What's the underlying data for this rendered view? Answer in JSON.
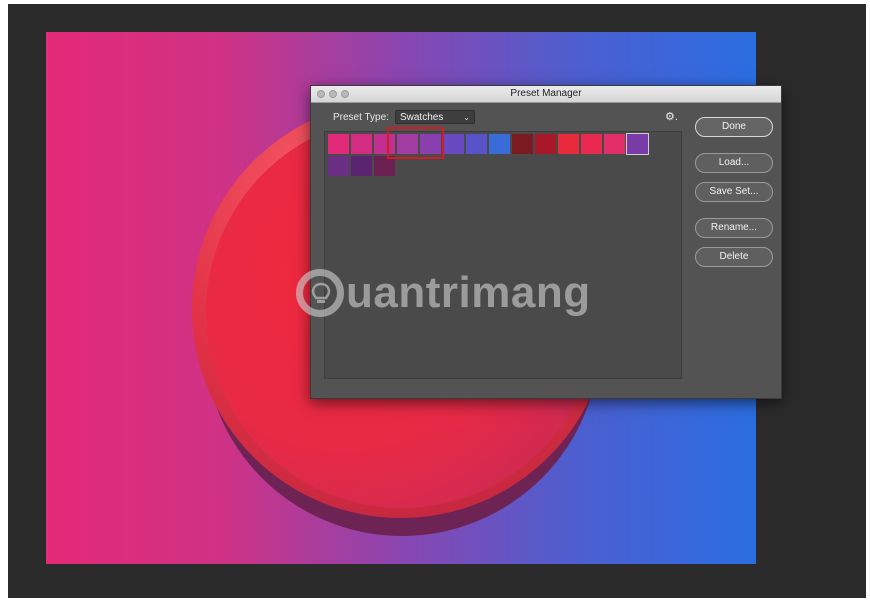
{
  "canvas": {
    "gradient_colors": [
      "#e42a78",
      "#cf3285",
      "#8a46b0",
      "#4c5fd0",
      "#2b6ee2"
    ],
    "circle_color": "#e82a45"
  },
  "dialog": {
    "title": "Preset Manager",
    "preset_type_label": "Preset Type:",
    "preset_type_value": "Swatches",
    "options_icon": "gear-icon",
    "swatches": [
      "#e3297a",
      "#d42c82",
      "#c13090",
      "#a23da4",
      "#8a3fae",
      "#6a4ac0",
      "#5a52c8",
      "#3a6cd8",
      "#7a1a22",
      "#a8182a",
      "#e82a3a",
      "#e82a50",
      "#e4306a",
      "#7a3aa8",
      "#6b2f86",
      "#5a2470",
      "#6a2050"
    ],
    "selected_swatch_index": 13,
    "buttons": {
      "done": "Done",
      "load": "Load...",
      "save_set": "Save Set...",
      "rename": "Rename...",
      "delete": "Delete"
    }
  },
  "watermark": {
    "text": "uantrimang"
  }
}
